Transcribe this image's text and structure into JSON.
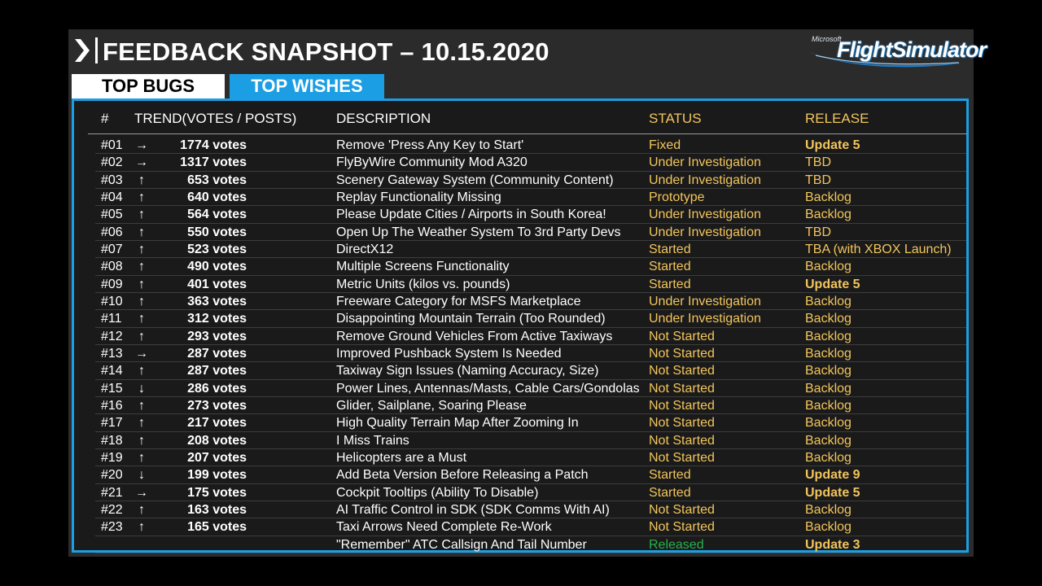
{
  "header": {
    "title": "FEEDBACK SNAPSHOT – 10.15.2020",
    "logo_brand": "Microsoft",
    "logo_name": "FlightSimulator"
  },
  "tabs": {
    "bugs_label": "TOP BUGS",
    "wishes_label": "TOP WISHES"
  },
  "table": {
    "headers": {
      "num": "#",
      "trend": "TREND(VOTES / POSTS)",
      "description": "DESCRIPTION",
      "status": "STATUS",
      "release": "RELEASE"
    },
    "rows": [
      {
        "num": "#01",
        "trend": "→",
        "votes": "1774 votes",
        "description": "Remove 'Press Any Key to Start'",
        "status": "Fixed",
        "release": "Update 5",
        "release_bold": true
      },
      {
        "num": "#02",
        "trend": "→",
        "votes": "1317 votes",
        "description": "FlyByWire Community Mod A320",
        "status": "Under Investigation",
        "release": "TBD",
        "release_bold": false
      },
      {
        "num": "#03",
        "trend": "↑",
        "votes": "653 votes",
        "description": "Scenery Gateway System (Community Content)",
        "status": "Under Investigation",
        "release": "TBD",
        "release_bold": false
      },
      {
        "num": "#04",
        "trend": "↑",
        "votes": "640 votes",
        "description": "Replay Functionality Missing",
        "status": "Prototype",
        "release": "Backlog",
        "release_bold": false
      },
      {
        "num": "#05",
        "trend": "↑",
        "votes": "564 votes",
        "description": "Please Update Cities / Airports in South Korea!",
        "status": "Under Investigation",
        "release": "Backlog",
        "release_bold": false
      },
      {
        "num": "#06",
        "trend": "↑",
        "votes": "550 votes",
        "description": "Open Up The Weather System To 3rd Party Devs",
        "status": "Under Investigation",
        "release": "TBD",
        "release_bold": false
      },
      {
        "num": "#07",
        "trend": "↑",
        "votes": "523 votes",
        "description": "DirectX12",
        "status": "Started",
        "release": "TBA (with XBOX Launch)",
        "release_bold": false
      },
      {
        "num": "#08",
        "trend": "↑",
        "votes": "490 votes",
        "description": "Multiple Screens Functionality",
        "status": "Started",
        "release": "Backlog",
        "release_bold": false
      },
      {
        "num": "#09",
        "trend": "↑",
        "votes": "401 votes",
        "description": "Metric Units (kilos vs. pounds)",
        "status": "Started",
        "release": "Update 5",
        "release_bold": true
      },
      {
        "num": "#10",
        "trend": "↑",
        "votes": "363 votes",
        "description": "Freeware Category for MSFS Marketplace",
        "status": "Under Investigation",
        "release": "Backlog",
        "release_bold": false
      },
      {
        "num": "#11",
        "trend": "↑",
        "votes": "312 votes",
        "description": "Disappointing Mountain Terrain (Too Rounded)",
        "status": "Under Investigation",
        "release": "Backlog",
        "release_bold": false
      },
      {
        "num": "#12",
        "trend": "↑",
        "votes": "293 votes",
        "description": "Remove Ground Vehicles From Active Taxiways",
        "status": "Not Started",
        "release": "Backlog",
        "release_bold": false
      },
      {
        "num": "#13",
        "trend": "→",
        "votes": "287 votes",
        "description": "Improved Pushback System Is Needed",
        "status": "Not Started",
        "release": "Backlog",
        "release_bold": false
      },
      {
        "num": "#14",
        "trend": "↑",
        "votes": "287 votes",
        "description": "Taxiway Sign Issues (Naming Accuracy, Size)",
        "status": "Not Started",
        "release": "Backlog",
        "release_bold": false
      },
      {
        "num": "#15",
        "trend": "↓",
        "votes": "286 votes",
        "description": "Power Lines, Antennas/Masts, Cable Cars/Gondolas",
        "status": "Not Started",
        "release": "Backlog",
        "release_bold": false
      },
      {
        "num": "#16",
        "trend": "↑",
        "votes": "273 votes",
        "description": "Glider, Sailplane, Soaring Please",
        "status": "Not Started",
        "release": "Backlog",
        "release_bold": false
      },
      {
        "num": "#17",
        "trend": "↑",
        "votes": "217 votes",
        "description": "High Quality Terrain Map After Zooming In",
        "status": "Not Started",
        "release": "Backlog",
        "release_bold": false
      },
      {
        "num": "#18",
        "trend": "↑",
        "votes": "208 votes",
        "description": "I Miss Trains",
        "status": "Not Started",
        "release": "Backlog",
        "release_bold": false
      },
      {
        "num": "#19",
        "trend": "↑",
        "votes": "207 votes",
        "description": "Helicopters are a Must",
        "status": "Not Started",
        "release": "Backlog",
        "release_bold": false
      },
      {
        "num": "#20",
        "trend": "↓",
        "votes": "199 votes",
        "description": "Add Beta Version Before Releasing a Patch",
        "status": "Started",
        "release": "Update 9",
        "release_bold": true
      },
      {
        "num": "#21",
        "trend": "→",
        "votes": "175 votes",
        "description": "Cockpit Tooltips (Ability To Disable)",
        "status": "Started",
        "release": "Update 5",
        "release_bold": true
      },
      {
        "num": "#22",
        "trend": "↑",
        "votes": "163 votes",
        "description": "AI Traffic Control in SDK (SDK Comms With AI)",
        "status": "Not Started",
        "release": "Backlog",
        "release_bold": false
      },
      {
        "num": "#23",
        "trend": "↑",
        "votes": "165 votes",
        "description": "Taxi Arrows Need Complete Re-Work",
        "status": "Not Started",
        "release": "Backlog",
        "release_bold": false
      },
      {
        "num": "",
        "trend": "",
        "votes": "",
        "description": "\"Remember\" ATC Callsign And Tail Number",
        "status": "Released",
        "release": "Update 3",
        "release_bold": true
      }
    ]
  },
  "colors": {
    "accent_blue": "#1b9ee3",
    "status_yellow": "#f2c55c",
    "released_green": "#27b24a"
  },
  "icons": {
    "header_chevron": "chevron-right-icon",
    "trend_right": "arrow-right-icon",
    "trend_up": "arrow-up-icon",
    "trend_down": "arrow-down-icon"
  }
}
